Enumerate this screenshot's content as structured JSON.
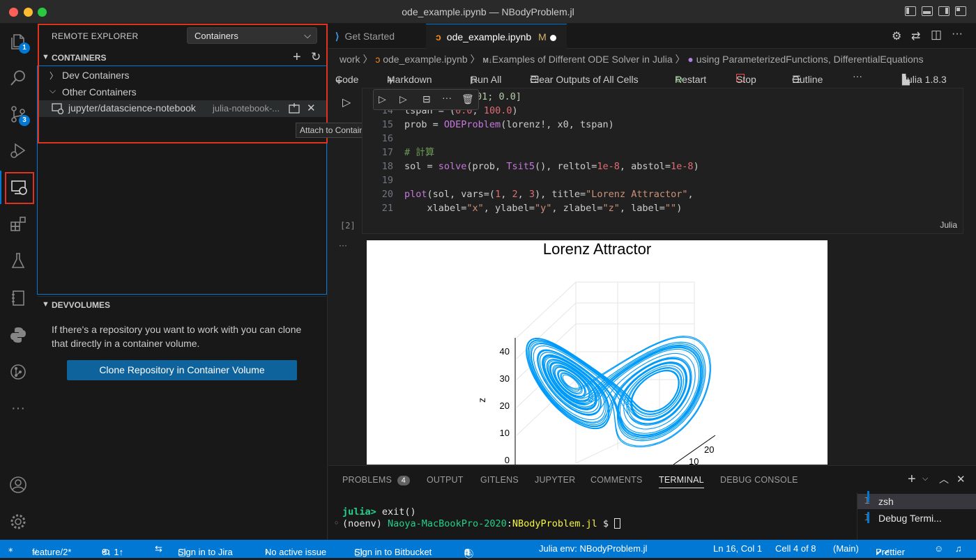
{
  "window": {
    "title": "ode_example.ipynb — NBodyProblem.jl"
  },
  "activity_bar": {
    "explorer_badge": "1",
    "scm_badge": "3"
  },
  "sidebar": {
    "header": "REMOTE EXPLORER",
    "selector_value": "Containers",
    "containers_section": "CONTAINERS",
    "dev_containers": "Dev Containers",
    "other_containers": "Other Containers",
    "container_name": "jupyter/datascience-notebook",
    "container_desc": "julia-notebook-...",
    "tooltip": "Attach to Container",
    "devvolumes_section": "DEVVOLUMES",
    "devvolumes_text": "If there's a repository you want to work with you can clone that directly in a container volume.",
    "clone_button": "Clone Repository in Container Volume"
  },
  "tabs": [
    {
      "label": "Get Started"
    },
    {
      "label": "ode_example.ipynb",
      "modified": "M"
    }
  ],
  "breadcrumb": {
    "folder": "work",
    "file": "ode_example.ipynb",
    "md_icon": "M↓",
    "section": "Examples of Different ODE Solver in Julia",
    "cell": "using ParameterizedFunctions, DifferentialEquations"
  },
  "notebook_toolbar": {
    "code": "Code",
    "markdown": "Markdown",
    "run_all": "Run All",
    "clear_outputs": "Clear Outputs of All Cells",
    "restart": "Restart",
    "stop": "Stop",
    "outline": "Outline",
    "more": "···",
    "kernel": "Julia 1.8.3"
  },
  "cell": {
    "exec_count": "[2]",
    "language": "Julia",
    "lines": [
      {
        "n": "14",
        "text": "tspan = (0.0, 100.0)"
      },
      {
        "n": "15",
        "text": "prob = ODEProblem(lorenz!, x0, tspan)"
      },
      {
        "n": "16",
        "text": ""
      },
      {
        "n": "17",
        "text": "# 計算"
      },
      {
        "n": "18",
        "text": "sol = solve(prob, Tsit5(), reltol=1e-8, abstol=1e-8)"
      },
      {
        "n": "19",
        "text": ""
      },
      {
        "n": "20",
        "text": "plot(sol, vars=(1, 2, 3), title=\"Lorenz Attractor\","
      },
      {
        "n": "21",
        "text": "    xlabel=\"x\", ylabel=\"y\", zlabel=\"z\", label=\"\")"
      }
    ],
    "partial_top": "01; 0.0]"
  },
  "output": {
    "ellipsis": "···",
    "plot_title": "Lorenz Attractor",
    "zlabel": "z",
    "z_ticks": [
      "40",
      "30",
      "20",
      "10",
      "0"
    ],
    "y_ticks": [
      "20",
      "10"
    ]
  },
  "panel": {
    "tabs": [
      "PROBLEMS",
      "OUTPUT",
      "GITLENS",
      "JUPYTER",
      "COMMENTS",
      "TERMINAL",
      "DEBUG CONSOLE"
    ],
    "problems_count": "4",
    "terminal_line1_prompt": "julia>",
    "terminal_line1_cmd": " exit()",
    "terminal_line2_env": "(noenv) ",
    "terminal_line2_host": "Naoya-MacBookPro-2020",
    "terminal_line2_sep": ":",
    "terminal_line2_dir": "NBodyProblem.jl",
    "terminal_line2_tail": " $ ",
    "terminals": [
      "zsh",
      "Debug Termi..."
    ]
  },
  "status_bar": {
    "branch": "feature/2*",
    "sync": "0↓ 1↑",
    "jira": "Sign in to Jira",
    "issue": "No active issue",
    "bitbucket": "Sign in to Bitbucket",
    "errors": "0",
    "warnings": "0",
    "infos": "4",
    "julia_env": "Julia env: NBodyProblem.jl",
    "position": "Ln 16, Col 1",
    "cell_pos": "Cell 4 of 8",
    "main": "(Main)",
    "prettier": "Prettier"
  },
  "colors": {
    "accent": "#0078d4",
    "highlight_box": "#e0321f",
    "status_bar": "#0078d4",
    "plot_line": "#009af9"
  }
}
